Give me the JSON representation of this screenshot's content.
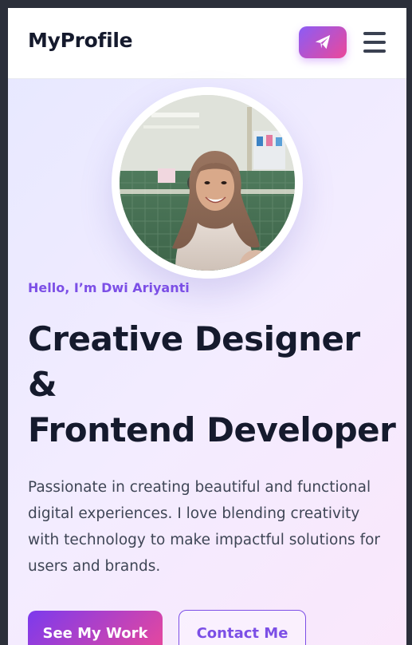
{
  "header": {
    "brand": "MyProfile",
    "send_icon": "paper-plane-icon",
    "menu_icon": "hamburger-menu-icon"
  },
  "hero": {
    "avatar_icon": "profile-photo",
    "greeting": "Hello, I’m Dwi Ariyanti",
    "headline_line1": "Creative Designer",
    "headline_line2": "&",
    "headline_line3": "Frontend Developer",
    "bio": "Passionate in creating beautiful and functional digital experiences. I love blending creativity with technology to make impactful solutions for users and brands."
  },
  "actions": {
    "primary_label": "See My Work",
    "secondary_label": "Contact Me"
  },
  "colors": {
    "accent": "#7c4fe6",
    "gradient_start": "#8b5cf6",
    "gradient_end": "#ec4899",
    "text_dark": "#151a2d"
  }
}
